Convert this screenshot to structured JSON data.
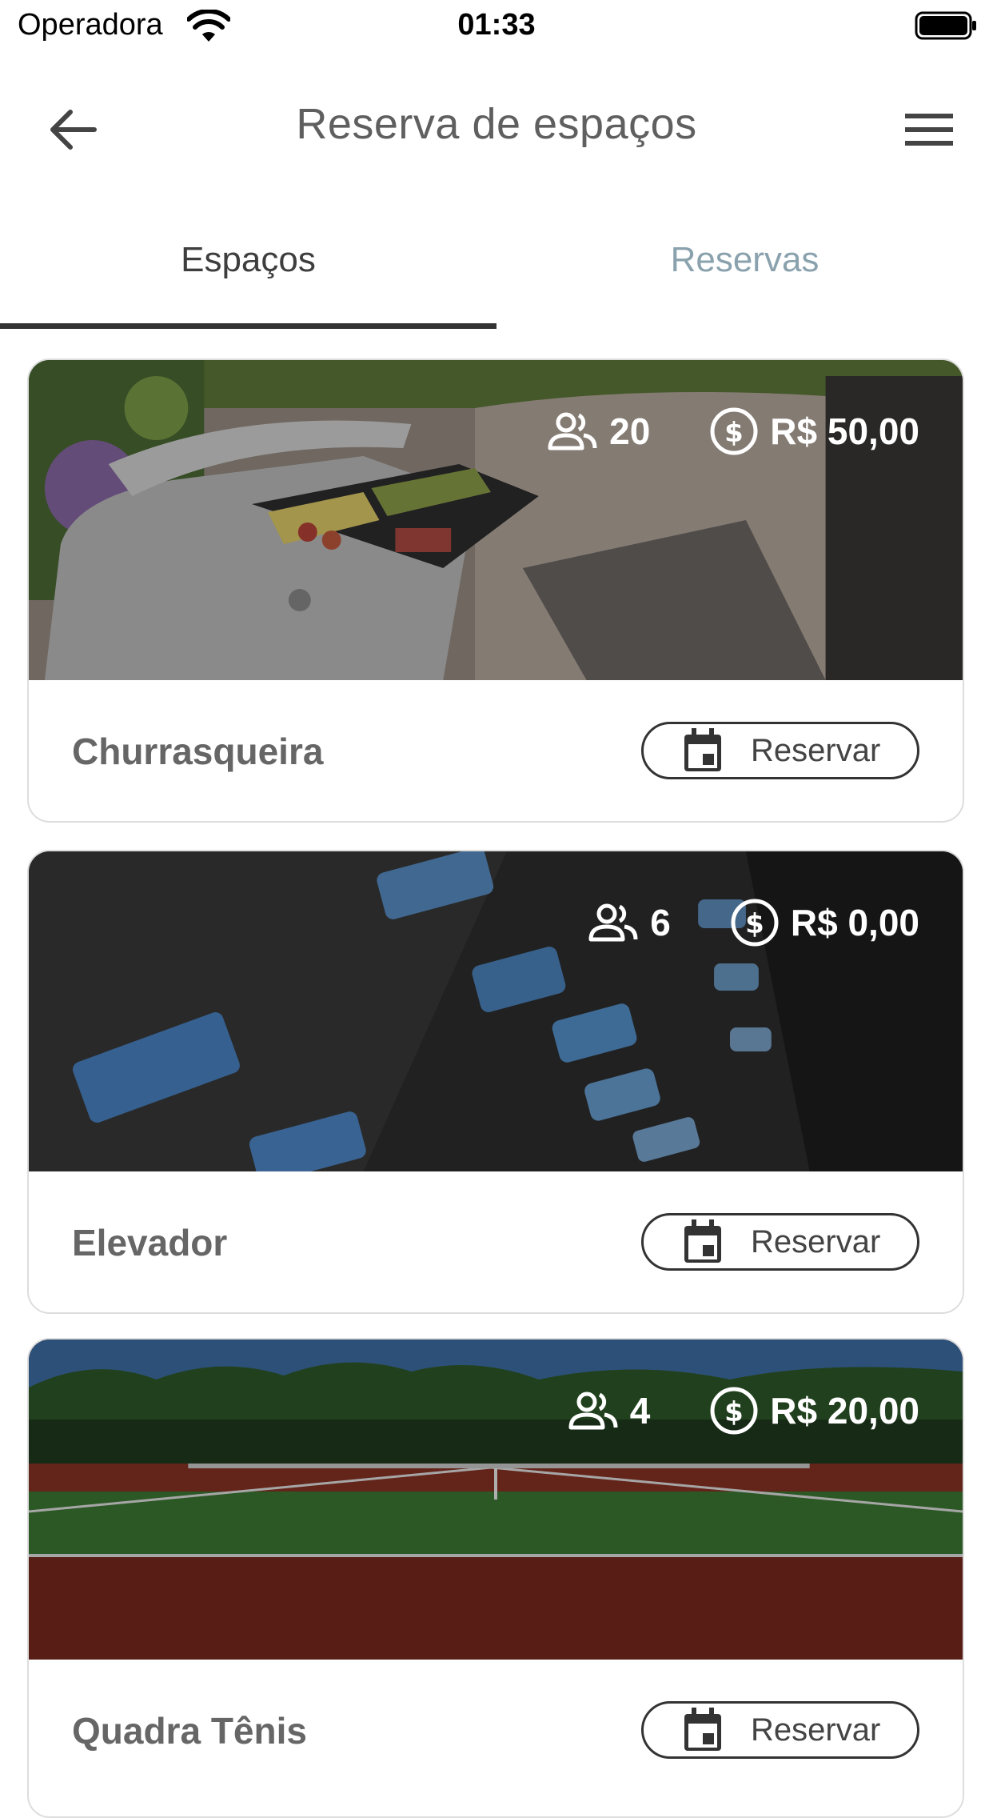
{
  "status_bar": {
    "carrier": "Operadora",
    "time": "01:33"
  },
  "app_bar": {
    "title": "Reserva de espaços",
    "back_icon": "arrow-left-icon",
    "menu_icon": "hamburger-menu-icon"
  },
  "tabs": [
    {
      "label": "Espaços",
      "active": true
    },
    {
      "label": "Reservas",
      "active": false
    }
  ],
  "spaces": [
    {
      "name": "Churrasqueira",
      "capacity": "20",
      "price": "R$ 50,00",
      "button_label": "Reservar",
      "image": "barbecue-grill-patio"
    },
    {
      "name": "Elevador",
      "capacity": "6",
      "price": "R$ 0,00",
      "button_label": "Reservar",
      "image": "elevator-buttons"
    },
    {
      "name": "Quadra Tênis",
      "capacity": "4",
      "price": "R$ 20,00",
      "button_label": "Reservar",
      "image": "tennis-court"
    }
  ],
  "icons": {
    "capacity": "people-group-icon",
    "price": "dollar-circle-icon",
    "reserve": "calendar-icon"
  }
}
